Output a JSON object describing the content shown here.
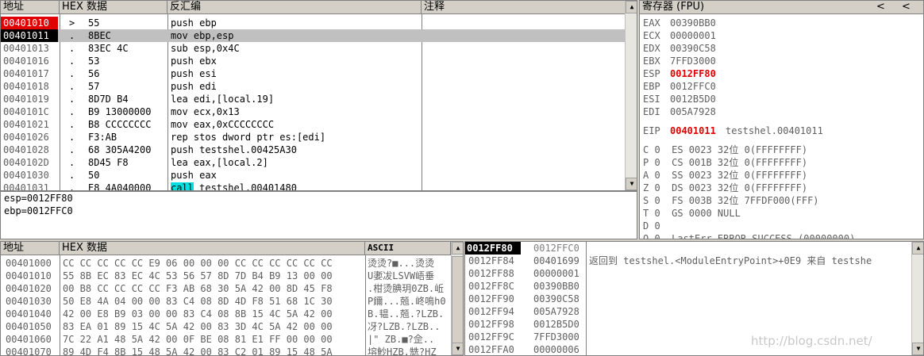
{
  "disasm": {
    "headers": {
      "address": "地址",
      "hex": "HEX 数据",
      "disasm": "反汇编",
      "comment": "注释"
    },
    "rows": [
      {
        "addr": "00401010",
        "marker": ">",
        "hex": "55",
        "disasm": "push ebp"
      },
      {
        "addr": "00401011",
        "marker": ".",
        "hex": "8BEC",
        "disasm": "mov ebp,esp"
      },
      {
        "addr": "00401013",
        "marker": ".",
        "hex": "83EC 4C",
        "disasm": "sub esp,0x4C"
      },
      {
        "addr": "00401016",
        "marker": ".",
        "hex": "53",
        "disasm": "push ebx"
      },
      {
        "addr": "00401017",
        "marker": ".",
        "hex": "56",
        "disasm": "push esi"
      },
      {
        "addr": "00401018",
        "marker": ".",
        "hex": "57",
        "disasm": "push edi"
      },
      {
        "addr": "00401019",
        "marker": ".",
        "hex": "8D7D B4",
        "disasm": "lea edi,[local.19]"
      },
      {
        "addr": "0040101C",
        "marker": ".",
        "hex": "B9 13000000",
        "disasm": "mov ecx,0x13"
      },
      {
        "addr": "00401021",
        "marker": ".",
        "hex": "B8 CCCCCCCC",
        "disasm": "mov eax,0xCCCCCCCC"
      },
      {
        "addr": "00401026",
        "marker": ".",
        "hex": "F3:AB",
        "disasm": "rep stos dword ptr es:[edi]"
      },
      {
        "addr": "00401028",
        "marker": ".",
        "hex": "68 305A4200",
        "disasm": "push testshel.00425A30"
      },
      {
        "addr": "0040102D",
        "marker": ".",
        "hex": "8D45 F8",
        "disasm": "lea eax,[local.2]"
      },
      {
        "addr": "00401030",
        "marker": ".",
        "hex": "50",
        "disasm": "push eax"
      },
      {
        "addr": "00401031",
        "marker": ".",
        "hex": "E8 4A040000",
        "disasm_kw": "call",
        "disasm": " testshel.00401480"
      }
    ]
  },
  "info": {
    "lines": [
      "esp=0012FF80",
      "ebp=0012FFC0"
    ]
  },
  "registers": {
    "title": "寄存器 (FPU)",
    "nav_left": "<",
    "nav_right": "<",
    "general": [
      {
        "name": "EAX",
        "value": "00390BB0",
        "changed": false
      },
      {
        "name": "ECX",
        "value": "00000001",
        "changed": false
      },
      {
        "name": "EDX",
        "value": "00390C58",
        "changed": false
      },
      {
        "name": "EBX",
        "value": "7FFD3000",
        "changed": false
      },
      {
        "name": "ESP",
        "value": "0012FF80",
        "changed": true
      },
      {
        "name": "EBP",
        "value": "0012FFC0",
        "changed": false
      },
      {
        "name": "ESI",
        "value": "0012B5D0",
        "changed": false
      },
      {
        "name": "EDI",
        "value": "005A7928",
        "changed": false
      }
    ],
    "eip": {
      "name": "EIP",
      "value": "00401011",
      "comment": "testshel.00401011"
    },
    "flags": [
      "C 0  ES 0023 32位 0(FFFFFFFF)",
      "P 0  CS 001B 32位 0(FFFFFFFF)",
      "A 0  SS 0023 32位 0(FFFFFFFF)",
      "Z 0  DS 0023 32位 0(FFFFFFFF)",
      "S 0  FS 003B 32位 7FFDF000(FFF)",
      "T 0  GS 0000 NULL",
      "D 0",
      "O 0  LastErr ERROR_SUCCESS (00000000)"
    ]
  },
  "dump": {
    "headers": {
      "address": "地址",
      "hex": "HEX 数据",
      "ascii": "ASCII"
    },
    "rows": [
      {
        "addr": "00401000",
        "hex": "CC CC CC CC CC E9 06 00 00 00 CC CC CC CC CC CC",
        "ascii": "烫烫?■...烫烫"
      },
      {
        "addr": "00401010",
        "hex": "55 8B EC 83 EC 4C 53 56 57 8D 7D B4 B9 13 00 00",
        "ascii": "U嬱冹LSVW峿垂"
      },
      {
        "addr": "00401020",
        "hex": "00 B8 CC CC CC CC F3 AB 68 30 5A 42 00 8D 45 F8",
        "ascii": ".柑烫腆玥0ZB.岴"
      },
      {
        "addr": "00401030",
        "hex": "50 E8 4A 04 00 00 83 C4 08 8D 4D F8 51 68 1C 30",
        "ascii": "P鑈...兡.峂鳴h0"
      },
      {
        "addr": "00401040",
        "hex": "42 00 E8 B9 03 00 00 83 C4 08 8B 15 4C 5A 42 00",
        "ascii": "B.韫..兡.?LZB."
      },
      {
        "addr": "00401050",
        "hex": "83 EA 01 89 15 4C 5A 42 00 83 3D 4C 5A 42 00 00",
        "ascii": "冴?LZB.?LZB.."
      },
      {
        "addr": "00401060",
        "hex": "7C 22 A1 48 5A 42 00 0F BE 08 81 E1 FF 00 00 00",
        "ascii": "|\" ZB.■?佱.."
      },
      {
        "addr": "00401070",
        "hex": "89 4D F4 8B 15 48 5A 42 00 83 C2 01 89 15 48 5A",
        "ascii": "塎魦HZB.兟?HZ"
      }
    ]
  },
  "stack": {
    "header_selected": "0012FF80",
    "header_second": "0012FFC0",
    "rows": [
      {
        "addr": "0012FF84",
        "value": "00401699",
        "comment": "返回到 testshel.<ModuleEntryPoint>+0E9 来自 testshe"
      },
      {
        "addr": "0012FF88",
        "value": "00000001",
        "comment": ""
      },
      {
        "addr": "0012FF8C",
        "value": "00390BB0",
        "comment": ""
      },
      {
        "addr": "0012FF90",
        "value": "00390C58",
        "comment": ""
      },
      {
        "addr": "0012FF94",
        "value": "005A7928",
        "comment": ""
      },
      {
        "addr": "0012FF98",
        "value": "0012B5D0",
        "comment": ""
      },
      {
        "addr": "0012FF9C",
        "value": "7FFD3000",
        "comment": ""
      },
      {
        "addr": "0012FFA0",
        "value": "00000006",
        "comment": ""
      }
    ]
  },
  "watermark": "http://blog.csdn.net/",
  "colors": {
    "selected_addr_bg": "#e00000",
    "current_addr_bg": "#000000",
    "current_row_bg": "#c0c0c0",
    "call_bg": "#00e0e0",
    "changed_reg": "#e00000"
  }
}
